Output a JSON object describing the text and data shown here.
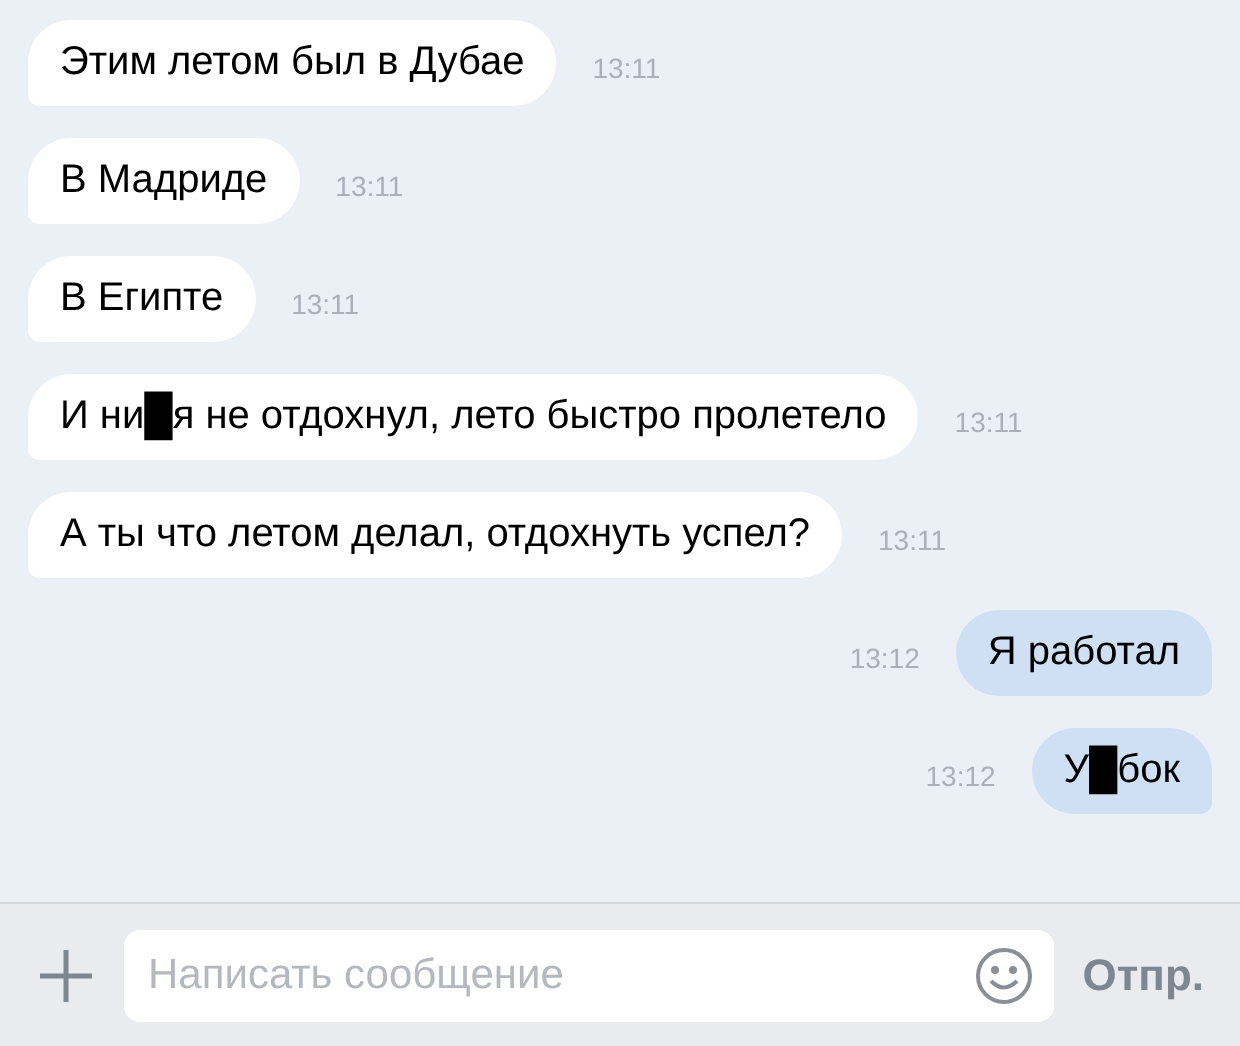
{
  "messages": [
    {
      "kind": "incoming",
      "text": "Этим летом был в Дубае",
      "time": "13:11"
    },
    {
      "kind": "incoming",
      "text": "В Мадриде",
      "time": "13:11"
    },
    {
      "kind": "incoming",
      "text": "В Египте",
      "time": "13:11"
    },
    {
      "kind": "incoming",
      "text": "И ни█я не отдохнул, лето быстро пролетело",
      "time": "13:11"
    },
    {
      "kind": "incoming",
      "text": "А ты что летом делал, отдохнуть успел?",
      "time": "13:11"
    },
    {
      "kind": "outgoing",
      "text": "Я работал",
      "time": "13:12"
    },
    {
      "kind": "outgoing",
      "text": "У█бок",
      "time": "13:12"
    }
  ],
  "composer": {
    "placeholder": "Написать сообщение",
    "send": "Отпр."
  }
}
